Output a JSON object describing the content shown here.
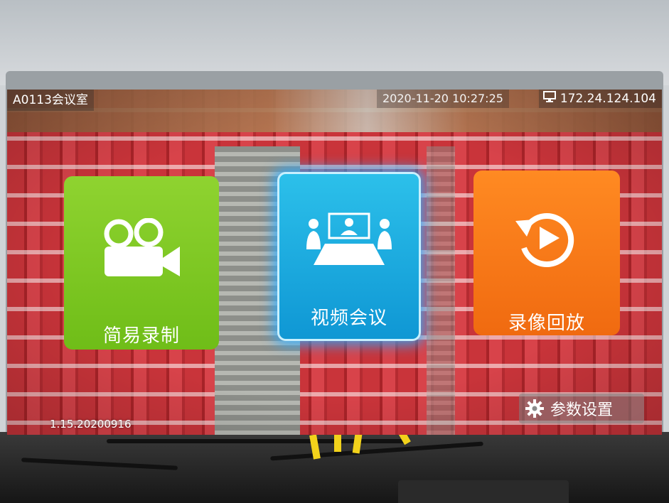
{
  "header": {
    "room_name": "A0113会议室",
    "datetime": "2020-11-20 10:27:25",
    "ip_address": "172.24.124.104"
  },
  "tiles": [
    {
      "id": "record",
      "label": "简易录制",
      "icon": "video-camera-icon",
      "color": "#7cc623"
    },
    {
      "id": "meeting",
      "label": "视频会议",
      "icon": "video-conference-icon",
      "color": "#1ba8dd"
    },
    {
      "id": "playback",
      "label": "录像回放",
      "icon": "replay-icon",
      "color": "#f7791a"
    }
  ],
  "settings": {
    "label": "参数设置",
    "icon": "gear-icon"
  },
  "footer": {
    "version": "1.15.20200916"
  }
}
